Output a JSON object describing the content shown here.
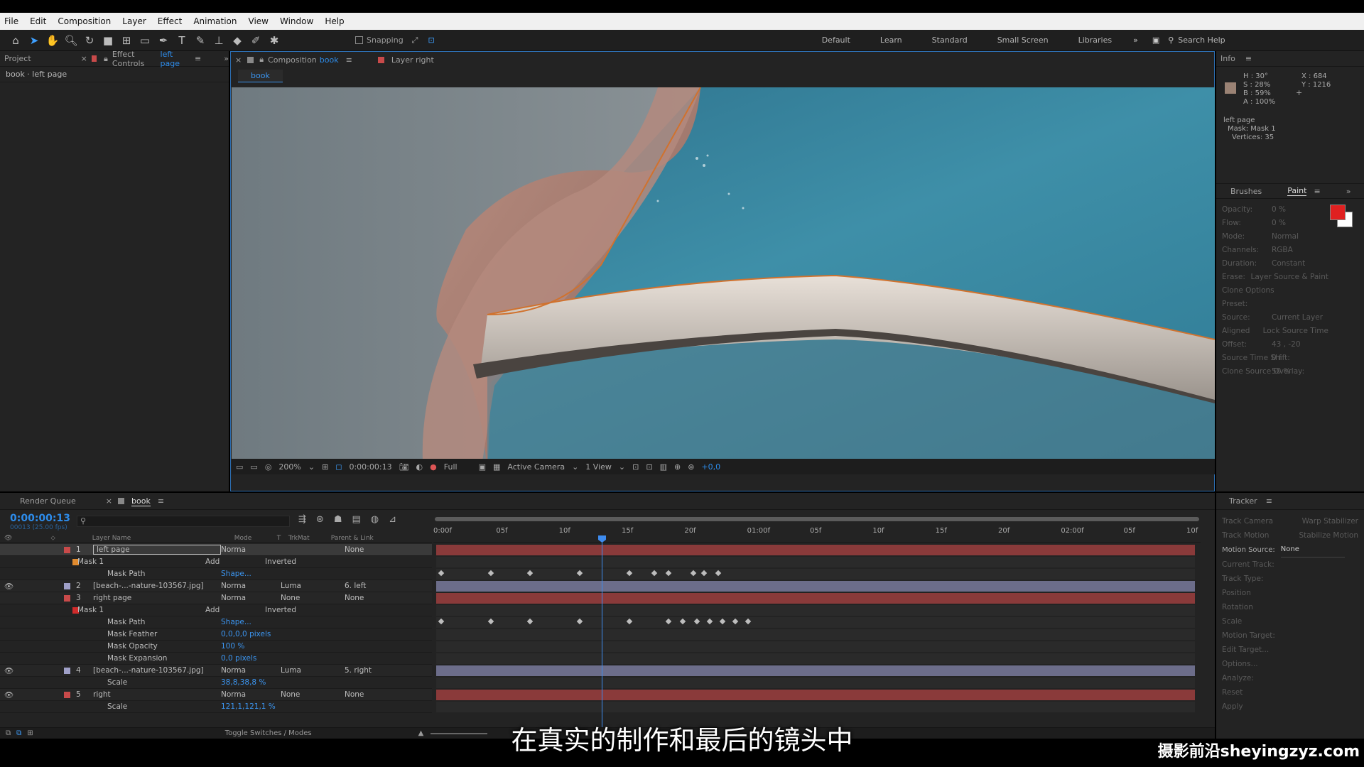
{
  "menu": [
    "File",
    "Edit",
    "Composition",
    "Layer",
    "Effect",
    "Animation",
    "View",
    "Window",
    "Help"
  ],
  "toolbar": {
    "snapping_label": "Snapping",
    "workspaces": [
      "Default",
      "Learn",
      "Standard",
      "Small Screen",
      "Libraries"
    ],
    "search_placeholder": "Search Help"
  },
  "project_panel": {
    "tab_project": "Project",
    "tab_effect_controls": "Effect Controls",
    "effect_controls_target": "left page",
    "breadcrumb": "book · left page"
  },
  "comp_panel": {
    "tab_composition": "Composition",
    "comp_name": "book",
    "tab_layer": "Layer right",
    "comp_subtab": "book",
    "viewer_bar": {
      "zoom": "200%",
      "timecode": "0:00:00:13",
      "resolution": "Full",
      "camera": "Active Camera",
      "views": "1 View",
      "exposure": "+0,0"
    }
  },
  "info_panel": {
    "title": "Info",
    "h": "H : 30°",
    "s": "S : 28%",
    "b": "B : 59%",
    "a": "A : 100%",
    "x": "X : 684",
    "y": "Y : 1216",
    "details": [
      "left page",
      "Mask: Mask 1",
      "Vertices: 35"
    ]
  },
  "paint_panel": {
    "tab_brushes": "Brushes",
    "tab_paint": "Paint",
    "fg_color": "#e02020",
    "bg_color": "#ffffff",
    "rows": [
      {
        "label": "Opacity:",
        "value": "0 %"
      },
      {
        "label": "Flow:",
        "value": "0 %"
      },
      {
        "label": "Mode:",
        "value": "Normal"
      },
      {
        "label": "Channels:",
        "value": "RGBA"
      },
      {
        "label": "Duration:",
        "value": "Constant"
      },
      {
        "label": "Erase:",
        "value": "Layer Source & Paint"
      },
      {
        "label": "Clone Options",
        "value": ""
      },
      {
        "label": "Preset:",
        "value": ""
      },
      {
        "label": "Source:",
        "value": "Current Layer"
      },
      {
        "label": "Aligned",
        "value": "Lock Source Time"
      },
      {
        "label": "Offset:",
        "value": "43 , -20"
      },
      {
        "label": "Source Time Shift:",
        "value": "0 f"
      },
      {
        "label": "Clone Source Overlay:",
        "value": "50 %"
      }
    ]
  },
  "timeline": {
    "tab_render_queue": "Render Queue",
    "tab_comp": "book",
    "timecode": "0:00:00:13",
    "fps": "00013 (25.00 fps)",
    "columns": [
      "Layer Name",
      "Mode",
      "T",
      "TrkMat",
      "Parent & Link"
    ],
    "ruler": [
      "0:00f",
      "05f",
      "10f",
      "15f",
      "20f",
      "01:00f",
      "05f",
      "10f",
      "15f",
      "20f",
      "02:00f",
      "05f",
      "10f"
    ],
    "footer": "Toggle Switches / Modes",
    "rows": [
      {
        "num": "1",
        "name": "left page",
        "mode": "Norma",
        "trkmat": "",
        "parent": "None",
        "kind": "layer",
        "color": "#c84a4a"
      },
      {
        "num": "",
        "name": "Mask 1",
        "mode": "Add",
        "trkmat": "Inverted",
        "parent": "",
        "kind": "mask",
        "color": "#e08a2e"
      },
      {
        "num": "",
        "name": "Mask Path",
        "mode": "Shape...",
        "trkmat": "",
        "parent": "",
        "kind": "prop",
        "color": ""
      },
      {
        "num": "2",
        "name": "[beach-...-nature-103567.jpg]",
        "mode": "Norma",
        "trkmat": "Luma",
        "parent": "6. left",
        "kind": "layer",
        "color": "#9fa0c8"
      },
      {
        "num": "3",
        "name": "right page",
        "mode": "Norma",
        "trkmat": "None",
        "parent": "None",
        "kind": "layer",
        "color": "#c84a4a"
      },
      {
        "num": "",
        "name": "Mask 1",
        "mode": "Add",
        "trkmat": "Inverted",
        "parent": "",
        "kind": "mask",
        "color": "#d02b2b"
      },
      {
        "num": "",
        "name": "Mask Path",
        "mode": "Shape...",
        "trkmat": "",
        "parent": "",
        "kind": "prop",
        "color": ""
      },
      {
        "num": "",
        "name": "Mask Feather",
        "mode": "0,0,0,0 pixels",
        "trkmat": "",
        "parent": "",
        "kind": "prop",
        "color": ""
      },
      {
        "num": "",
        "name": "Mask Opacity",
        "mode": "100 %",
        "trkmat": "",
        "parent": "",
        "kind": "prop",
        "color": ""
      },
      {
        "num": "",
        "name": "Mask Expansion",
        "mode": "0,0 pixels",
        "trkmat": "",
        "parent": "",
        "kind": "prop",
        "color": ""
      },
      {
        "num": "4",
        "name": "[beach-...-nature-103567.jpg]",
        "mode": "Norma",
        "trkmat": "Luma",
        "parent": "5. right",
        "kind": "layer",
        "color": "#9fa0c8"
      },
      {
        "num": "",
        "name": "Scale",
        "mode": "38,8,38,8 %",
        "trkmat": "",
        "parent": "",
        "kind": "prop",
        "color": ""
      },
      {
        "num": "5",
        "name": "right",
        "mode": "Norma",
        "trkmat": "None",
        "parent": "None",
        "kind": "layer",
        "color": "#c84a4a"
      },
      {
        "num": "",
        "name": "Scale",
        "mode": "121,1,121,1 %",
        "trkmat": "",
        "parent": "",
        "kind": "prop",
        "color": ""
      }
    ]
  },
  "tracker_panel": {
    "title": "Tracker",
    "buttons": [
      "Track Camera",
      "Warp Stabilizer",
      "Track Motion",
      "Stabilize Motion"
    ],
    "motion_source_label": "Motion Source:",
    "motion_source_value": "None",
    "rows": [
      "Current Track:",
      "Track Type:",
      "Position",
      "Rotation",
      "Scale",
      "Motion Target:",
      "Edit Target...",
      "Options...",
      "Analyze:",
      "Reset",
      "Apply"
    ]
  },
  "subtitle": "在真实的制作和最后的镜头中",
  "watermark": "摄影前沿sheyingzyz.com"
}
